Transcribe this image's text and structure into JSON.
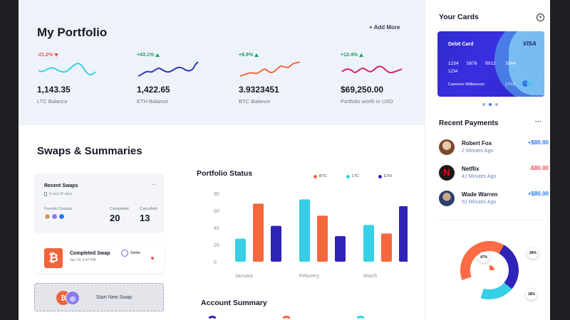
{
  "portfolio": {
    "title": "My Portfolio",
    "add_more": "+ Add More",
    "coins": [
      {
        "change": "-21.2%",
        "direction": "down",
        "value": "1,143.35",
        "label": "LTC Balance",
        "color": "#36d3e8"
      },
      {
        "change": "+43.1%",
        "direction": "up",
        "value": "1,422.65",
        "label": "ETH Balance",
        "color": "#2c3ab0"
      },
      {
        "change": "+8.9%",
        "direction": "up",
        "value": "3.9323451",
        "label": "BTC Balance",
        "color": "#f4683c"
      },
      {
        "change": "+12.4%",
        "direction": "up",
        "value": "$69,250.00",
        "label": "Portfolio worth in USD",
        "color": "#d8265f"
      }
    ]
  },
  "swaps": {
    "title": "Swaps & Summaries",
    "recent": {
      "title": "Recent Swaps",
      "more": "··",
      "subtitle": "In last 30 days",
      "favorites_label": "Favorite Contacts",
      "completed_label": "Completed",
      "completed_value": "20",
      "cancelled_label": "Cancelled",
      "cancelled_value": "13"
    },
    "completed_swap": {
      "coin_symbol": "₿",
      "title": "Completed Swap",
      "date": "Jun 14, 5:47 PM",
      "network": "Steller"
    },
    "new_swap": {
      "icon_a": "₿",
      "icon_b": "◎",
      "label": "Start New Swap"
    }
  },
  "status_chart": {
    "title": "Portfolio Status",
    "legend": [
      {
        "name": "BTC",
        "color": "#f4683c"
      },
      {
        "name": "LTC",
        "color": "#36cfe6"
      },
      {
        "name": "ETH",
        "color": "#2f23b8"
      }
    ]
  },
  "chart_data": {
    "type": "bar",
    "categories": [
      "January",
      "Feburery",
      "March"
    ],
    "series": [
      {
        "name": "LTC",
        "values": [
          27,
          73,
          43
        ]
      },
      {
        "name": "BTC",
        "values": [
          68,
          54,
          33
        ]
      },
      {
        "name": "ETH",
        "values": [
          42,
          30,
          65
        ]
      }
    ],
    "yticks": [
      "80",
      "60",
      "40",
      "20",
      "0"
    ],
    "ylim": [
      0,
      80
    ],
    "grid": false,
    "legend_position": "top-right"
  },
  "account_summary": {
    "title": "Account Summary"
  },
  "sidebar": {
    "cards_title": "Your Cards",
    "add_icon": "+",
    "card": {
      "label": "Debit Card",
      "brand": "VISA",
      "numbers": [
        "1234",
        "5678",
        "9012",
        "3544"
      ],
      "line2": "1234",
      "holder": "Cameron Williamson",
      "expiry": "17/12"
    },
    "payments_title": "Recent Payments",
    "payments_more": "···",
    "payments": [
      {
        "name": "Robert Fox",
        "time": "2 Minutes Ago",
        "amount": "+$80.00",
        "sign": "pos"
      },
      {
        "name": "Netflix",
        "time": "41 Minutes Ago",
        "amount": "-$80.00",
        "sign": "neg"
      },
      {
        "name": "Wade Warren",
        "time": "52 Minutes Ago",
        "amount": "+$80.00",
        "sign": "pos"
      }
    ],
    "donut_labels": [
      "47%",
      "28%",
      "18%"
    ]
  },
  "colors": {
    "ltc": "#36cfe6",
    "btc": "#f4683c",
    "eth": "#2f23b8",
    "accent": "#3b6fe0"
  }
}
